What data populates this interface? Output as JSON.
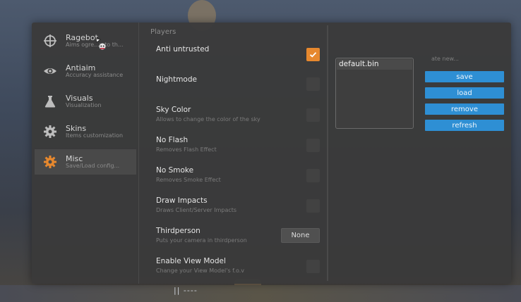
{
  "sidebar": {
    "items": [
      {
        "title": "Ragebot",
        "subtitle": "Aims ogre...y to th...",
        "icon": "crosshair-icon"
      },
      {
        "title": "Antiaim",
        "subtitle": "Accuracy assistance",
        "icon": "eye-icon"
      },
      {
        "title": "Visuals",
        "subtitle": "Visualization",
        "icon": "flask-icon"
      },
      {
        "title": "Skins",
        "subtitle": "Items customization",
        "icon": "gear-icon"
      },
      {
        "title": "Misc",
        "subtitle": "Save/Load config...",
        "icon": "gear-icon",
        "active": true
      }
    ]
  },
  "main": {
    "section_label": "Players",
    "options": [
      {
        "title": "Anti untrusted",
        "subtitle": "",
        "control": "checkbox",
        "checked": true
      },
      {
        "title": "Nightmode",
        "subtitle": "",
        "control": "checkbox",
        "checked": false
      },
      {
        "title": "Sky Color",
        "subtitle": "Allows to change the color of the sky",
        "control": "checkbox",
        "checked": false
      },
      {
        "title": "No Flash",
        "subtitle": "Removes Flash Effect",
        "control": "checkbox",
        "checked": false
      },
      {
        "title": "No Smoke",
        "subtitle": "Removes Smoke Effect",
        "control": "checkbox",
        "checked": false
      },
      {
        "title": "Draw Impacts",
        "subtitle": "Draws Client/Server Impacts",
        "control": "checkbox",
        "checked": false
      },
      {
        "title": "Thirdperson",
        "subtitle": "Puts your camera in thirdperson",
        "control": "select",
        "value": "None"
      },
      {
        "title": "Enable View Model",
        "subtitle": "Change your View Model's f.o.v",
        "control": "checkbox",
        "checked": false
      }
    ]
  },
  "config": {
    "list": [
      "default.bin"
    ],
    "new_label": "ate new...",
    "buttons": {
      "save": "save",
      "load": "load",
      "remove": "remove",
      "refresh": "refresh"
    }
  },
  "background": {
    "floor_text": "||  ----"
  },
  "colors": {
    "accent_orange": "#e6882e",
    "button_blue": "#2e8fd4",
    "window_bg": "#3a3a3a"
  }
}
